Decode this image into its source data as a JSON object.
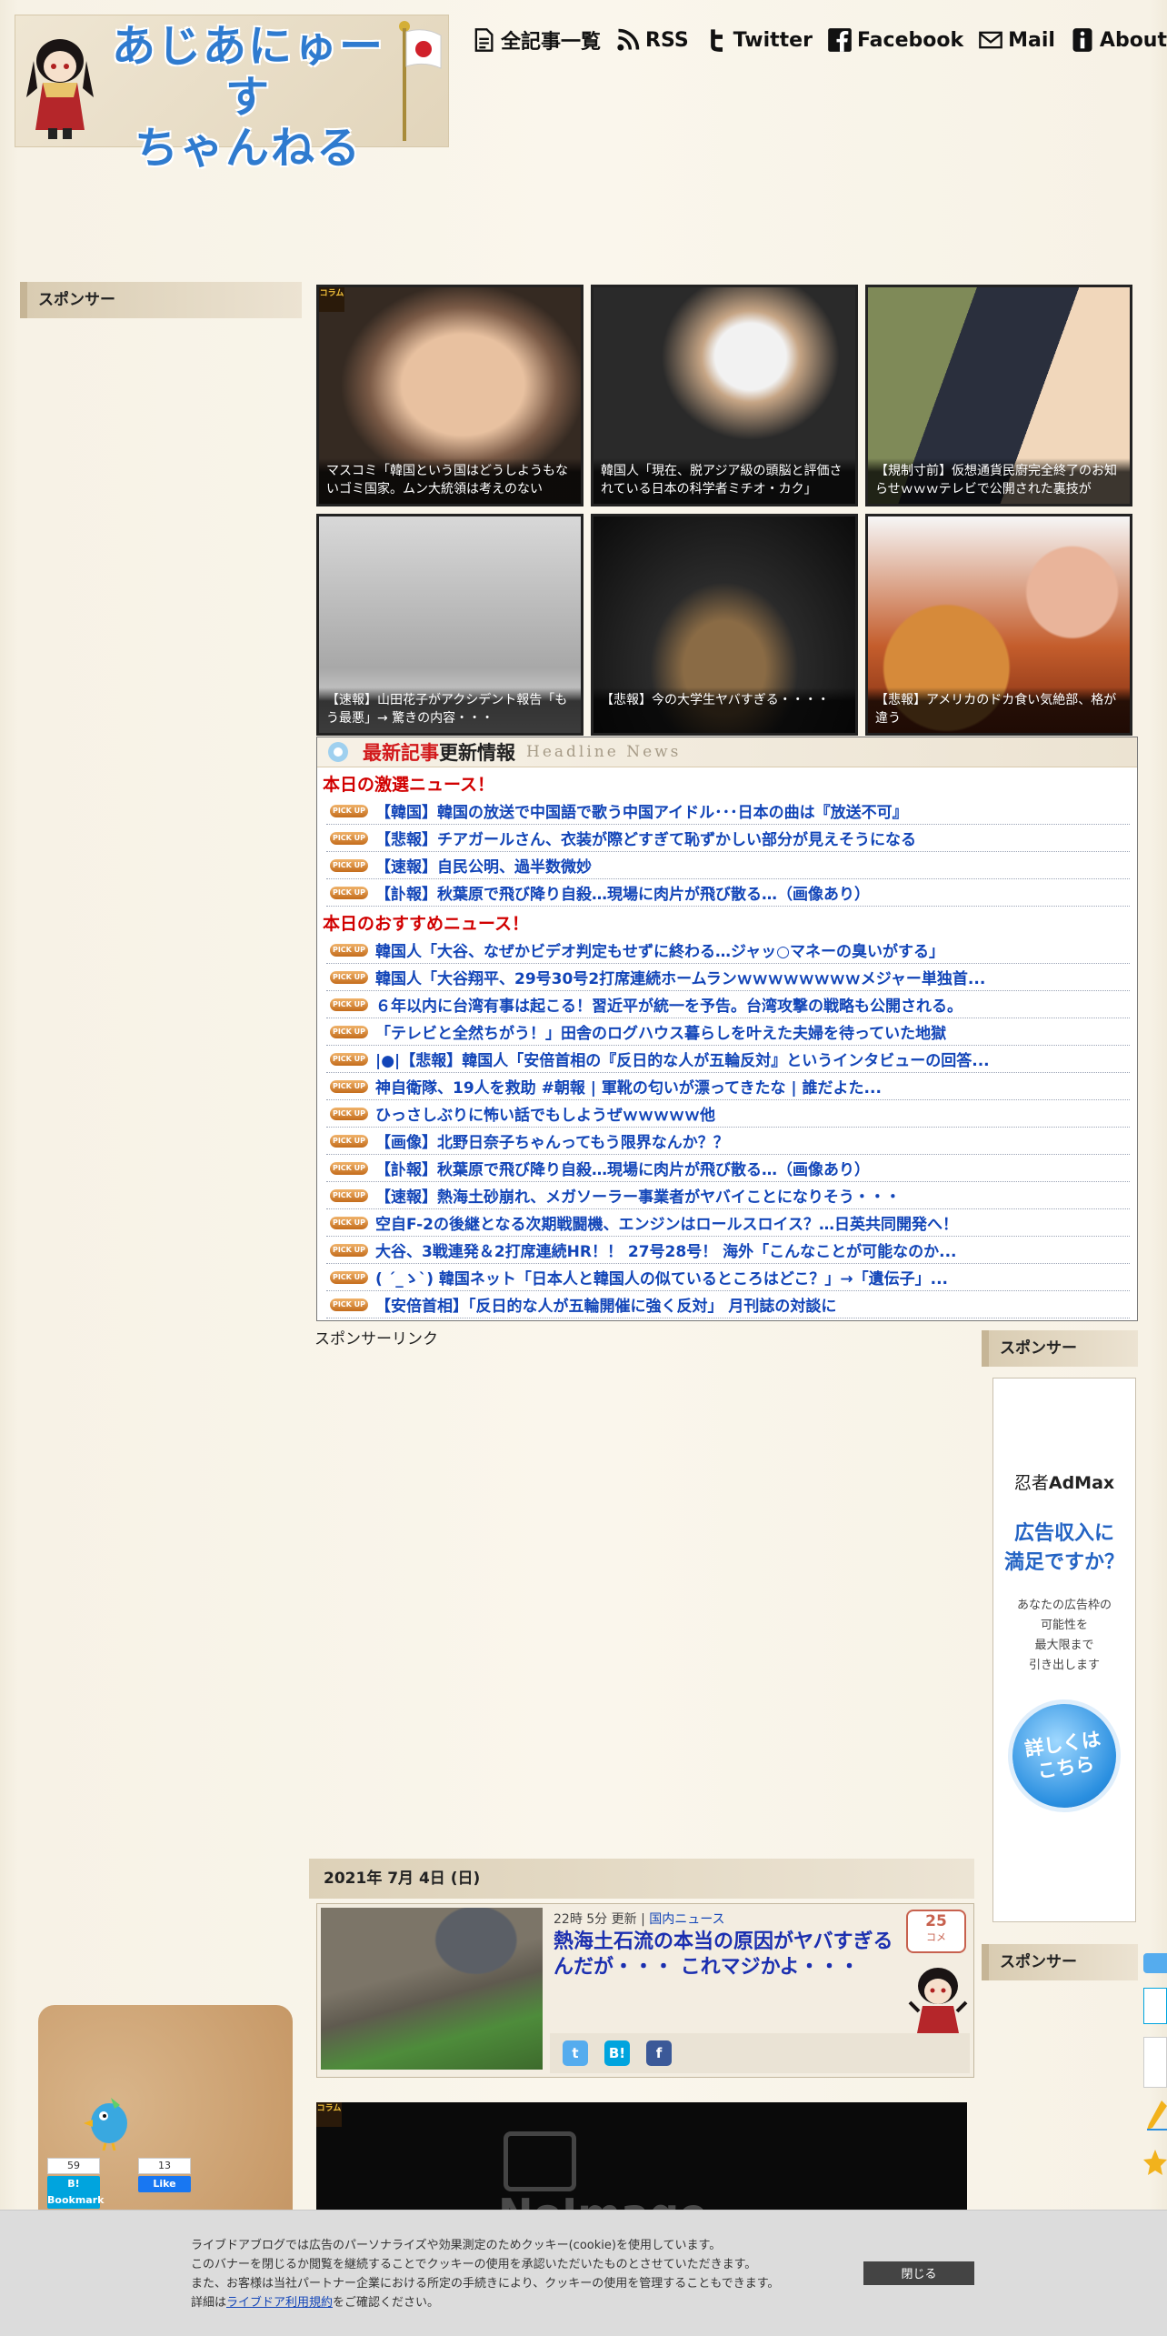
{
  "site": {
    "logo_line1": "あじあにゅーす",
    "logo_line2": "ちゃんねる"
  },
  "nav": [
    {
      "label": "全記事一覧",
      "icon": "document-icon"
    },
    {
      "label": "RSS",
      "icon": "rss-icon"
    },
    {
      "label": "Twitter",
      "icon": "twitter-icon"
    },
    {
      "label": "Facebook",
      "icon": "facebook-icon"
    },
    {
      "label": "Mail",
      "icon": "mail-icon"
    },
    {
      "label": "About",
      "icon": "info-icon"
    }
  ],
  "sidebar": {
    "left_heading": "スポンサー",
    "right_heading_1": "スポンサー",
    "right_heading_2": "スポンサー"
  },
  "thumbs": [
    {
      "caption": "マスコミ「韓国という国はどうしようもないゴミ国家。ムン大統領は考えのない",
      "badge": "コラム"
    },
    {
      "caption": "韓国人「現在、脱アジア級の頭脳と評価されている日本の科学者ミチオ・カク」",
      "badge": ""
    },
    {
      "caption": "【規制寸前】仮想通貨民廚完全終了のお知らせｗｗｗテレビで公開された裏技が",
      "badge": ""
    },
    {
      "caption": "【速報】山田花子がアクシデント報告「もう最悪」→ 驚きの内容・・・",
      "badge": ""
    },
    {
      "caption": "【悲報】今の大学生ヤバすぎる・・・・",
      "badge": ""
    },
    {
      "caption": "【悲報】アメリカのドカ食い気絶部、格が違う",
      "badge": ""
    }
  ],
  "news": {
    "heading_red": "最新記事",
    "heading_black": "更新情報",
    "heading_en": "Headline News",
    "pickup_label": "PICK UP",
    "section1": "本日の激選ニュース！",
    "items1": [
      "【韓国】韓国の放送で中国語で歌う中国アイドル･･･日本の曲は『放送不可』",
      "【悲報】チアガールさん、衣装が際どすぎて恥ずかしい部分が見えそうになる",
      "【速報】自民公明、過半数微妙",
      "【訃報】秋葉原で飛び降り自殺…現場に肉片が飛び散る…（画像あり）"
    ],
    "section2": "本日のおすすめニュース！",
    "items2": [
      "韓国人「大谷、なぜかビデオ判定もせずに終わる…ジャッ○マネーの臭いがする」",
      "韓国人「大谷翔平、29号30号2打席連続ホームランｗｗｗｗｗｗｗｗメジャー単独首...",
      "６年以内に台湾有事は起こる！習近平が統一を予告。台湾攻撃の戦略も公開される。",
      "「テレビと全然ちがう！」田舎のログハウス暮らしを叶えた夫婦を待っていた地獄",
      "|●|【悲報】韓国人「安倍首相の『反日的な人が五輪反対』というインタビューの回答...",
      "神自衛隊、19人を救助 #朝報 | 軍靴の匂いが漂ってきたな | 誰だよた...",
      "ひっさしぶりに怖い話でもしようぜｗｗｗｗｗ他",
      "【画像】北野日奈子ちゃんってもう限界なんか？？",
      "【訃報】秋葉原で飛び降り自殺…現場に肉片が飛び散る…（画像あり）",
      "【速報】熱海土砂崩れ、メガソーラー事業者がヤバイことになりそう・・・",
      "空自F-2の後継となる次期戦闘機、エンジンはロールスロイス？…日英共同開発へ！",
      "大谷、3戦連発＆2打席連続HR！！ 27号28号！ 海外「こんなことが可能なのか...",
      "( ´_ゝ`) 韓国ネット「日本人と韓国人の似ているところはどこ？」→「遺伝子」...",
      "【安倍首相】「反日的な人が五輪開催に強く反対」 月刊誌の対談に"
    ]
  },
  "sponsor_link": "スポンサーリンク",
  "ad": {
    "brand_a": "忍者",
    "brand_b": "AdMax",
    "headline_1": "広告収入に",
    "headline_2": "満足ですか？",
    "sub_1": "あなたの広告枠の",
    "sub_2": "可能性を",
    "sub_3": "最大限まで",
    "sub_4": "引き出します",
    "button_1": "詳しくは",
    "button_2": "こちら"
  },
  "article": {
    "date": "2021年 7月 4日 (日)",
    "time": "22時 5分 更新",
    "separator": "|",
    "category": "国内ニュース",
    "title": "熱海土石流の本当の原因がヤバすぎるんだが・・・ これマジかよ・・・",
    "comments": "25",
    "comments_unit": "コメ"
  },
  "noimage": {
    "label": "NoImage",
    "badge": "コラム"
  },
  "hatena": [
    {
      "count": "59",
      "label": "B! Bookmark",
      "color": "#00a4de"
    },
    {
      "count": "13",
      "label": "Like",
      "color": "#1877f2"
    }
  ],
  "cookie": {
    "line1": "ライブドアブログでは広告のパーソナライズや効果測定のためクッキー(cookie)を使用しています。",
    "line2": "このバナーを閉じるか閲覧を継続することでクッキーの使用を承認いただいたものとさせていただきます。",
    "line3": "また、お客様は当社パートナー企業における所定の手続きにより、クッキーの使用を管理することもできます。",
    "line4_pre": "詳細は",
    "line4_link": "ライブドア利用規約",
    "line4_post": "をご確認ください。",
    "close": "閉じる"
  },
  "colors": {
    "link": "#1245b8",
    "section_red": "#d10000",
    "twitter": "#55acee",
    "hatena": "#00a4de",
    "facebook": "#3b5998"
  }
}
